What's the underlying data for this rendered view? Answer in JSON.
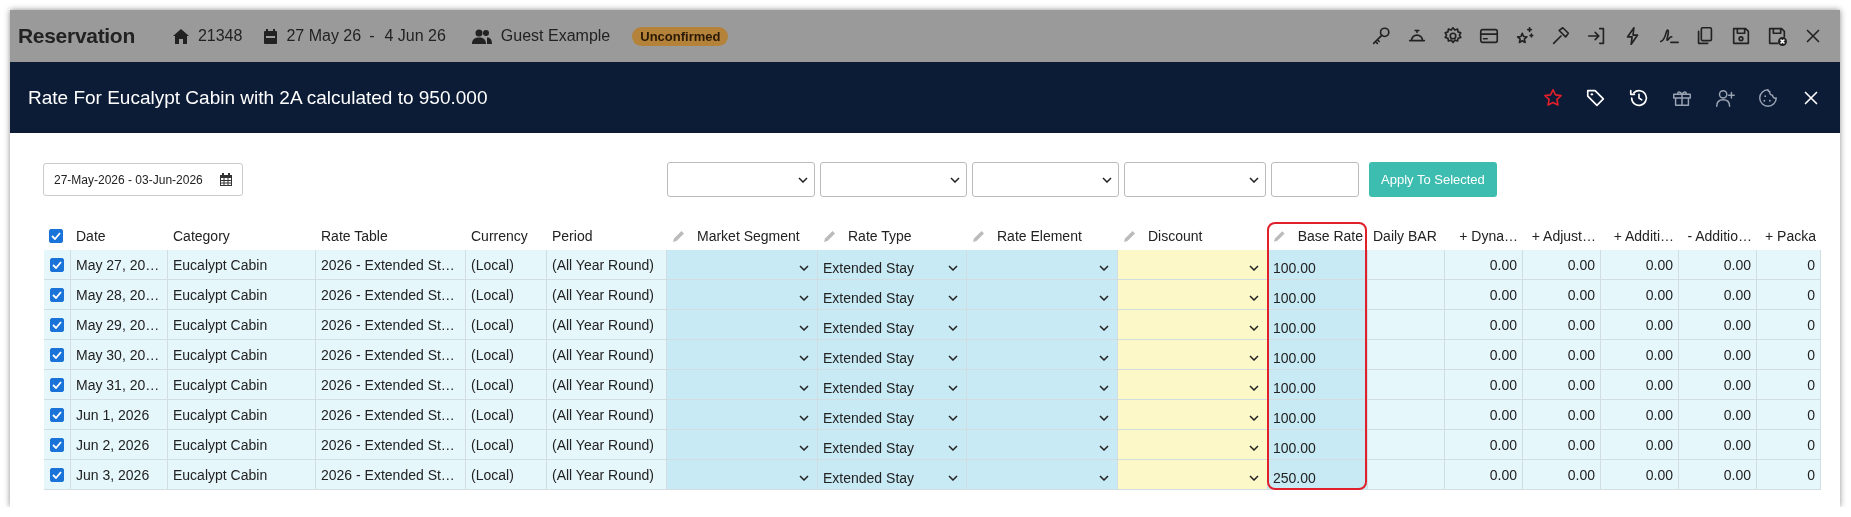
{
  "top_bar": {
    "title": "Reservation",
    "reservation_number": "21348",
    "date_from": "27 May 26",
    "date_separator": "-",
    "date_to": "4 Jun 26",
    "guest": "Guest Example",
    "status": "Unconfirmed"
  },
  "modal": {
    "title": "Rate For Eucalypt Cabin with 2A calculated to 950.000"
  },
  "filters": {
    "date_range": "27-May-2026 - 03-Jun-2026",
    "apply_button": "Apply To Selected"
  },
  "table": {
    "select_all_checked": true,
    "columns": [
      {
        "label": "Date",
        "kind": "text",
        "editable": false,
        "highlighted": false
      },
      {
        "label": "Category",
        "kind": "text",
        "editable": false,
        "highlighted": false
      },
      {
        "label": "Rate Table",
        "kind": "text",
        "editable": false,
        "highlighted": false
      },
      {
        "label": "Currency",
        "kind": "text",
        "editable": false,
        "highlighted": false
      },
      {
        "label": "Period",
        "kind": "text",
        "editable": false,
        "highlighted": false
      },
      {
        "label": "Market Segment",
        "kind": "choice",
        "editable": true,
        "highlighted": false
      },
      {
        "label": "Rate Type",
        "kind": "choice",
        "editable": true,
        "highlighted": false
      },
      {
        "label": "Rate Element",
        "kind": "choice",
        "editable": true,
        "highlighted": false
      },
      {
        "label": "Discount",
        "kind": "discount",
        "editable": true,
        "highlighted": false
      },
      {
        "label": "Base Rate",
        "kind": "rate",
        "editable": true,
        "highlighted": true
      },
      {
        "label": "Daily BAR",
        "kind": "plain",
        "editable": false,
        "highlighted": false
      },
      {
        "label": "+ Dyna…",
        "kind": "amount",
        "editable": false,
        "highlighted": false
      },
      {
        "label": "+ Adjust…",
        "kind": "amount",
        "editable": false,
        "highlighted": false
      },
      {
        "label": "+ Additi…",
        "kind": "amount",
        "editable": false,
        "highlighted": false
      },
      {
        "label": "- Additio…",
        "kind": "amount",
        "editable": false,
        "highlighted": false
      },
      {
        "label": "+ Packa",
        "kind": "amount",
        "editable": false,
        "highlighted": false
      }
    ],
    "rows": [
      {
        "checked": true,
        "cells": [
          {
            "value": "May 27, 20…"
          },
          {
            "value": "Eucalypt Cabin"
          },
          {
            "value": "2026 - Extended St…"
          },
          {
            "value": "(Local)"
          },
          {
            "value": "(All Year Round)"
          },
          {},
          {
            "value": "Extended Stay"
          },
          {},
          {},
          {
            "value": "100.00"
          },
          {},
          {
            "value": "0.00"
          },
          {
            "value": "0.00"
          },
          {
            "value": "0.00"
          },
          {
            "value": "0.00"
          },
          {
            "value": "0"
          }
        ]
      },
      {
        "checked": true,
        "cells": [
          {
            "value": "May 28, 20…"
          },
          {
            "value": "Eucalypt Cabin"
          },
          {
            "value": "2026 - Extended St…"
          },
          {
            "value": "(Local)"
          },
          {
            "value": "(All Year Round)"
          },
          {},
          {
            "value": "Extended Stay"
          },
          {},
          {},
          {
            "value": "100.00"
          },
          {},
          {
            "value": "0.00"
          },
          {
            "value": "0.00"
          },
          {
            "value": "0.00"
          },
          {
            "value": "0.00"
          },
          {
            "value": "0"
          }
        ]
      },
      {
        "checked": true,
        "cells": [
          {
            "value": "May 29, 20…"
          },
          {
            "value": "Eucalypt Cabin"
          },
          {
            "value": "2026 - Extended St…"
          },
          {
            "value": "(Local)"
          },
          {
            "value": "(All Year Round)"
          },
          {},
          {
            "value": "Extended Stay"
          },
          {},
          {},
          {
            "value": "100.00"
          },
          {},
          {
            "value": "0.00"
          },
          {
            "value": "0.00"
          },
          {
            "value": "0.00"
          },
          {
            "value": "0.00"
          },
          {
            "value": "0"
          }
        ]
      },
      {
        "checked": true,
        "cells": [
          {
            "value": "May 30, 20…"
          },
          {
            "value": "Eucalypt Cabin"
          },
          {
            "value": "2026 - Extended St…"
          },
          {
            "value": "(Local)"
          },
          {
            "value": "(All Year Round)"
          },
          {},
          {
            "value": "Extended Stay"
          },
          {},
          {},
          {
            "value": "100.00"
          },
          {},
          {
            "value": "0.00"
          },
          {
            "value": "0.00"
          },
          {
            "value": "0.00"
          },
          {
            "value": "0.00"
          },
          {
            "value": "0"
          }
        ]
      },
      {
        "checked": true,
        "cells": [
          {
            "value": "May 31, 20…"
          },
          {
            "value": "Eucalypt Cabin"
          },
          {
            "value": "2026 - Extended St…"
          },
          {
            "value": "(Local)"
          },
          {
            "value": "(All Year Round)"
          },
          {},
          {
            "value": "Extended Stay"
          },
          {},
          {},
          {
            "value": "100.00"
          },
          {},
          {
            "value": "0.00"
          },
          {
            "value": "0.00"
          },
          {
            "value": "0.00"
          },
          {
            "value": "0.00"
          },
          {
            "value": "0"
          }
        ]
      },
      {
        "checked": true,
        "cells": [
          {
            "value": "Jun 1, 2026"
          },
          {
            "value": "Eucalypt Cabin"
          },
          {
            "value": "2026 - Extended St…"
          },
          {
            "value": "(Local)"
          },
          {
            "value": "(All Year Round)"
          },
          {},
          {
            "value": "Extended Stay"
          },
          {},
          {},
          {
            "value": "100.00"
          },
          {},
          {
            "value": "0.00"
          },
          {
            "value": "0.00"
          },
          {
            "value": "0.00"
          },
          {
            "value": "0.00"
          },
          {
            "value": "0"
          }
        ]
      },
      {
        "checked": true,
        "cells": [
          {
            "value": "Jun 2, 2026"
          },
          {
            "value": "Eucalypt Cabin"
          },
          {
            "value": "2026 - Extended St…"
          },
          {
            "value": "(Local)"
          },
          {
            "value": "(All Year Round)"
          },
          {},
          {
            "value": "Extended Stay"
          },
          {},
          {},
          {
            "value": "100.00"
          },
          {},
          {
            "value": "0.00"
          },
          {
            "value": "0.00"
          },
          {
            "value": "0.00"
          },
          {
            "value": "0.00"
          },
          {
            "value": "0"
          }
        ]
      },
      {
        "checked": true,
        "cells": [
          {
            "value": "Jun 3, 2026"
          },
          {
            "value": "Eucalypt Cabin"
          },
          {
            "value": "2026 - Extended St…"
          },
          {
            "value": "(Local)"
          },
          {
            "value": "(All Year Round)"
          },
          {},
          {
            "value": "Extended Stay"
          },
          {},
          {},
          {
            "value": "250.00"
          },
          {},
          {
            "value": "0.00"
          },
          {
            "value": "0.00"
          },
          {
            "value": "0.00"
          },
          {
            "value": "0.00"
          },
          {
            "value": "0"
          }
        ]
      }
    ]
  }
}
